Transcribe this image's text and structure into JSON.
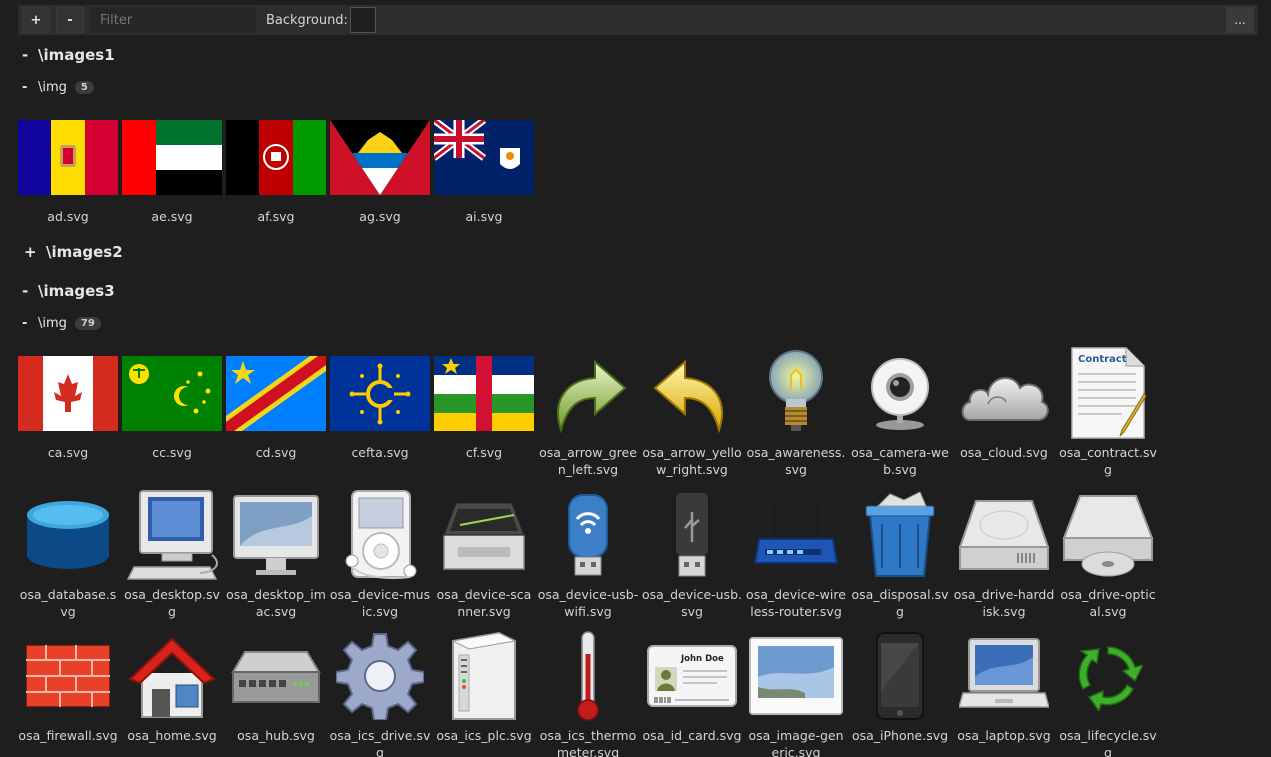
{
  "toolbar": {
    "zoom_in": "+",
    "zoom_out": "-",
    "filter_placeholder": "Filter",
    "background_label": "Background:",
    "more_label": "..."
  },
  "groups": [
    {
      "toggle": "-",
      "title": "\\images1"
    },
    {
      "toggle": "+",
      "title": "\\images2"
    },
    {
      "toggle": "-",
      "title": "\\images3"
    }
  ],
  "folders": [
    {
      "toggle": "-",
      "name": "\\img",
      "count": "5"
    },
    {
      "toggle": "-",
      "name": "\\img",
      "count": "79"
    }
  ],
  "images1": [
    "ad.svg",
    "ae.svg",
    "af.svg",
    "ag.svg",
    "ai.svg"
  ],
  "images3": [
    "ca.svg",
    "cc.svg",
    "cd.svg",
    "cefta.svg",
    "cf.svg",
    "osa_arrow_green_left.svg",
    "osa_arrow_yellow_right.svg",
    "osa_awareness.svg",
    "osa_camera-web.svg",
    "osa_cloud.svg",
    "osa_contract.svg",
    "osa_database.svg",
    "osa_desktop.svg",
    "osa_desktop_imac.svg",
    "osa_device-music.svg",
    "osa_device-scanner.svg",
    "osa_device-usb-wifi.svg",
    "osa_device-usb.svg",
    "osa_device-wireless-router.svg",
    "osa_disposal.svg",
    "osa_drive-harddisk.svg",
    "osa_drive-optical.svg",
    "osa_firewall.svg",
    "osa_home.svg",
    "osa_hub.svg",
    "osa_ics_drive.svg",
    "osa_ics_plc.svg",
    "osa_ics_thermometer.svg",
    "osa_id_card.svg",
    "osa_image-generic.svg",
    "osa_iPhone.svg",
    "osa_laptop.svg",
    "osa_lifecycle.svg"
  ],
  "graphics": {
    "contract_text": "Contract",
    "id_card_name": "John Doe"
  }
}
